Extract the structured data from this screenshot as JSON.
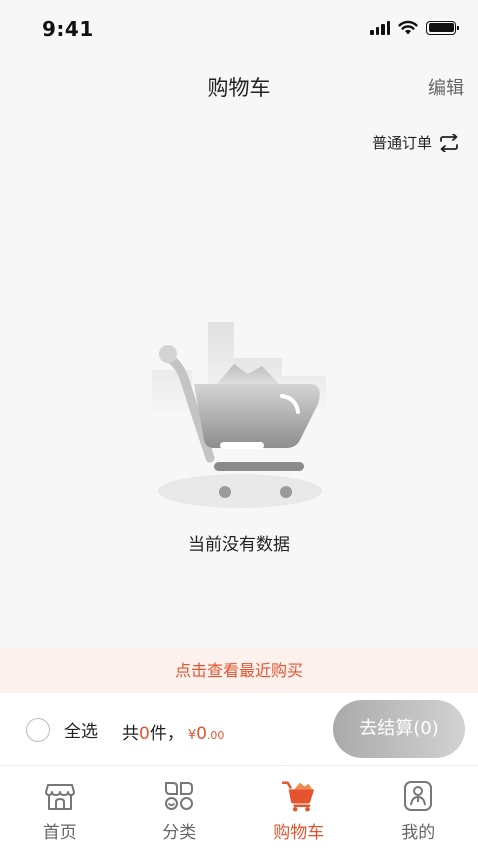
{
  "status_bar": {
    "time": "9:41"
  },
  "nav": {
    "title": "购物车",
    "edit_label": "编辑"
  },
  "order_switch": {
    "label": "普通订单"
  },
  "empty_state": {
    "message": "当前没有数据"
  },
  "recent_banner": {
    "label": "点击查看最近购买"
  },
  "checkout": {
    "select_all_label": "全选",
    "count_prefix": "共",
    "count": "0",
    "count_suffix": "件，",
    "currency": "¥",
    "amount": "0",
    "cents": ".00",
    "button_label": "去结算(0)"
  },
  "tabs": [
    {
      "label": "首页",
      "icon": "storefront-icon",
      "active": false
    },
    {
      "label": "分类",
      "icon": "category-icon",
      "active": false
    },
    {
      "label": "购物车",
      "icon": "cart-icon",
      "active": true
    },
    {
      "label": "我的",
      "icon": "profile-icon",
      "active": false
    }
  ],
  "colors": {
    "accent": "#e4552f",
    "banner_bg": "#fdf1ee",
    "page_bg": "#f7f7f7"
  }
}
